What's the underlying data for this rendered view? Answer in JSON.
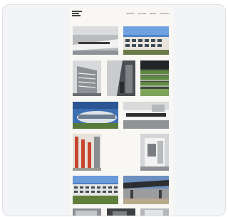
{
  "site": {
    "logo_text": "",
    "nav": [
      "WORKS",
      "STUDIO",
      "NEWS",
      "CONTACT"
    ]
  },
  "gallery": {
    "items": [
      {
        "icon": "building-photo",
        "tone": "gray"
      },
      {
        "icon": "building-photo",
        "tone": "blue-sky"
      },
      {
        "icon": "building-photo",
        "tone": "gray"
      },
      {
        "icon": "building-photo",
        "tone": "gray"
      },
      {
        "icon": "building-photo",
        "tone": "green"
      },
      {
        "icon": "building-photo",
        "tone": "blue-sky"
      },
      {
        "icon": "building-photo",
        "tone": "gray"
      },
      {
        "icon": "building-photo",
        "tone": "red-orange"
      },
      {
        "icon": "building-photo",
        "tone": "gray"
      },
      {
        "icon": "building-photo",
        "tone": "blue-sky"
      },
      {
        "icon": "building-photo",
        "tone": "gray"
      },
      {
        "icon": "building-photo",
        "tone": "gray"
      },
      {
        "icon": "building-photo",
        "tone": "gray"
      },
      {
        "icon": "building-photo",
        "tone": "gray"
      }
    ]
  }
}
